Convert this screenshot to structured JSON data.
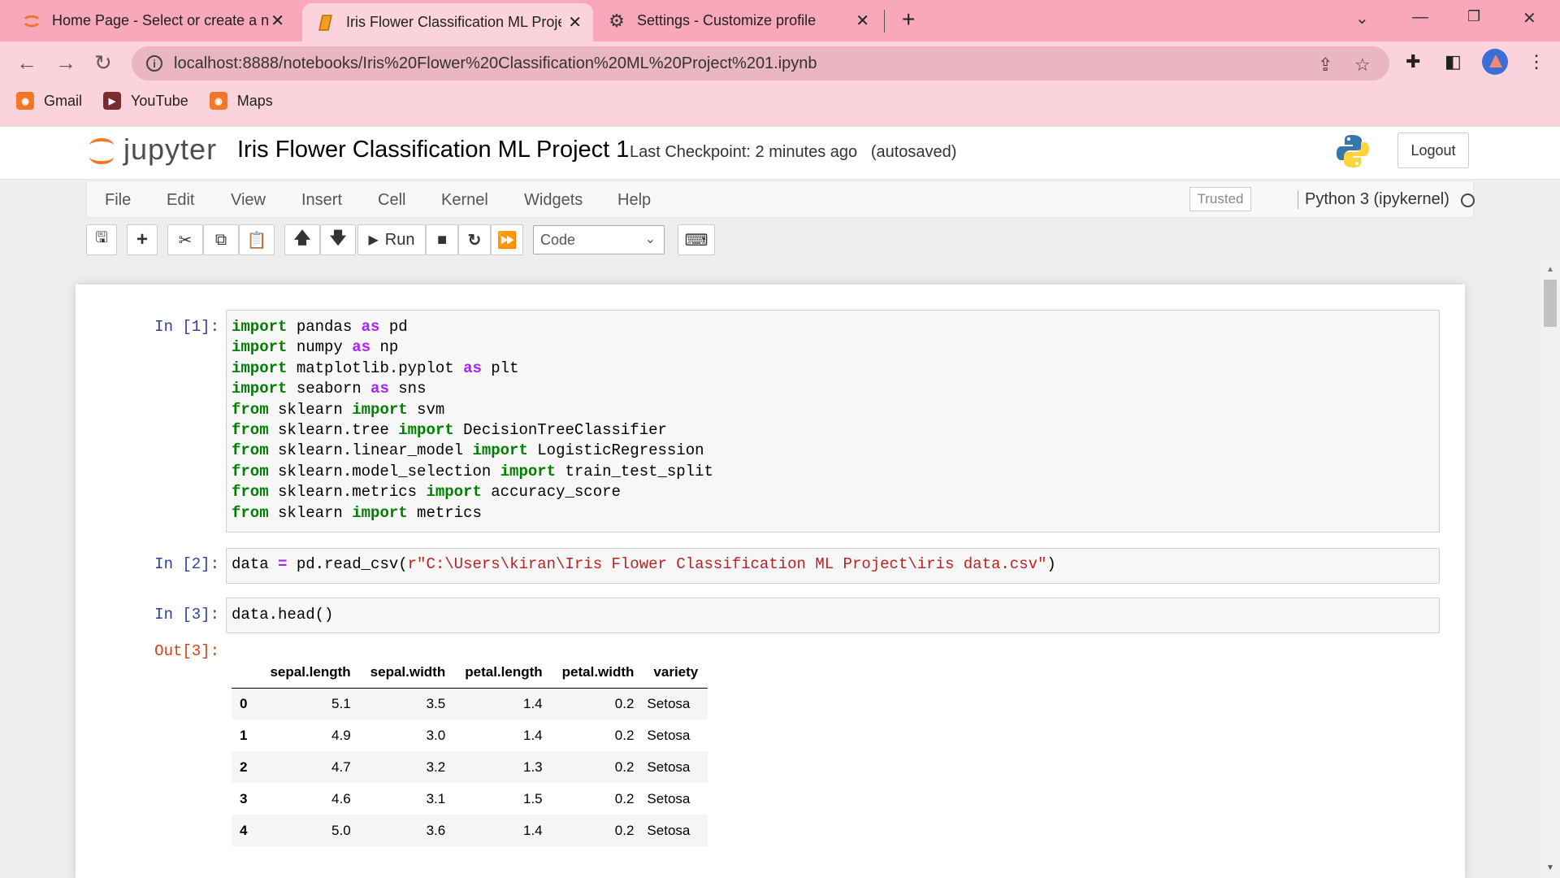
{
  "browser": {
    "tabs": [
      {
        "title": "Home Page - Select or create a n",
        "icon": "jupyter-icon"
      },
      {
        "title": "Iris Flower Classification ML Proje",
        "icon": "notebook-icon"
      },
      {
        "title": "Settings - Customize profile",
        "icon": "gear-icon"
      }
    ],
    "url": "localhost:8888/notebooks/Iris%20Flower%20Classification%20ML%20Project%201.ipynb",
    "bookmarks": [
      "Gmail",
      "YouTube",
      "Maps"
    ],
    "tab_color": "#f9a7ba",
    "toolbar_color": "#fbd3dc"
  },
  "jupyter": {
    "logo_text": "jupyter",
    "notebook_title": "Iris Flower Classification ML Project 1",
    "checkpoint": "Last Checkpoint: 2 minutes ago",
    "autosave": "(autosaved)",
    "logout": "Logout",
    "menu": [
      "File",
      "Edit",
      "View",
      "Insert",
      "Cell",
      "Kernel",
      "Widgets",
      "Help"
    ],
    "trusted": "Trusted",
    "kernel": "Python 3 (ipykernel)",
    "run_label": "Run",
    "cell_type": "Code"
  },
  "cells": [
    {
      "prompt": "In [1]:",
      "lines": [
        [
          [
            "kw",
            "import"
          ],
          [
            "t",
            " pandas "
          ],
          [
            "op",
            "as"
          ],
          [
            "t",
            " pd"
          ]
        ],
        [
          [
            "kw",
            "import"
          ],
          [
            "t",
            " numpy "
          ],
          [
            "op",
            "as"
          ],
          [
            "t",
            " np"
          ]
        ],
        [
          [
            "kw",
            "import"
          ],
          [
            "t",
            " matplotlib.pyplot "
          ],
          [
            "op",
            "as"
          ],
          [
            "t",
            " plt"
          ]
        ],
        [
          [
            "kw",
            "import"
          ],
          [
            "t",
            " seaborn "
          ],
          [
            "op",
            "as"
          ],
          [
            "t",
            " sns"
          ]
        ],
        [
          [
            "kw",
            "from"
          ],
          [
            "t",
            " sklearn "
          ],
          [
            "kw",
            "import"
          ],
          [
            "t",
            " svm"
          ]
        ],
        [
          [
            "kw",
            "from"
          ],
          [
            "t",
            " sklearn.tree "
          ],
          [
            "kw",
            "import"
          ],
          [
            "t",
            " DecisionTreeClassifier"
          ]
        ],
        [
          [
            "kw",
            "from"
          ],
          [
            "t",
            " sklearn.linear_model "
          ],
          [
            "kw",
            "import"
          ],
          [
            "t",
            " LogisticRegression"
          ]
        ],
        [
          [
            "kw",
            "from"
          ],
          [
            "t",
            " sklearn.model_selection "
          ],
          [
            "kw",
            "import"
          ],
          [
            "t",
            " train_test_split"
          ]
        ],
        [
          [
            "kw",
            "from"
          ],
          [
            "t",
            " sklearn.metrics "
          ],
          [
            "kw",
            "import"
          ],
          [
            "t",
            " accuracy_score"
          ]
        ],
        [
          [
            "kw",
            "from"
          ],
          [
            "t",
            " sklearn "
          ],
          [
            "kw",
            "import"
          ],
          [
            "t",
            " metrics"
          ]
        ]
      ]
    },
    {
      "prompt": "In [2]:",
      "lines": [
        [
          [
            "t",
            "data "
          ],
          [
            "op",
            "="
          ],
          [
            "t",
            " pd.read_csv("
          ],
          [
            "str",
            "r\"C:\\Users\\kiran\\Iris Flower Classification ML Project\\iris data.csv\""
          ],
          [
            "t",
            ")"
          ]
        ]
      ]
    },
    {
      "prompt": "In [3]:",
      "lines": [
        [
          [
            "t",
            "data.head()"
          ]
        ]
      ]
    }
  ],
  "output": {
    "prompt": "Out[3]:",
    "columns": [
      "",
      "sepal.length",
      "sepal.width",
      "petal.length",
      "petal.width",
      "variety"
    ],
    "rows": [
      [
        "0",
        "5.1",
        "3.5",
        "1.4",
        "0.2",
        "Setosa"
      ],
      [
        "1",
        "4.9",
        "3.0",
        "1.4",
        "0.2",
        "Setosa"
      ],
      [
        "2",
        "4.7",
        "3.2",
        "1.3",
        "0.2",
        "Setosa"
      ],
      [
        "3",
        "4.6",
        "3.1",
        "1.5",
        "0.2",
        "Setosa"
      ],
      [
        "4",
        "5.0",
        "3.6",
        "1.4",
        "0.2",
        "Setosa"
      ]
    ]
  }
}
